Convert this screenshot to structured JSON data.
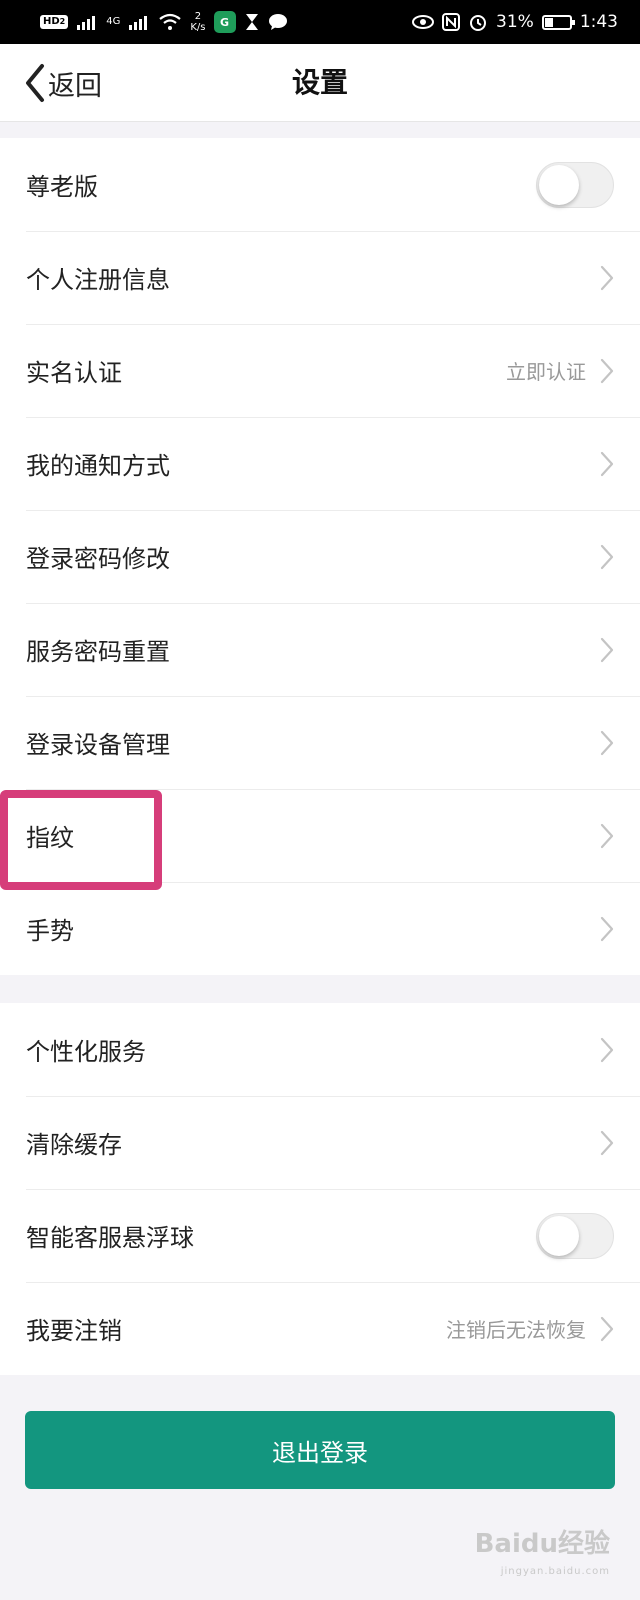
{
  "status_bar": {
    "left_badge": "HD",
    "left_badge_sub": "2",
    "signal1_icon": "signal-x-icon",
    "network_type": "4G",
    "speed_value": "2",
    "speed_unit": "K/s",
    "app_icon_label": "G",
    "battery_percent": "31%",
    "battery_level": 0.31,
    "time": "1:43"
  },
  "nav": {
    "back_label": "返回",
    "title": "设置"
  },
  "group1": {
    "items": [
      {
        "label": "尊老版",
        "type": "toggle",
        "on": false
      },
      {
        "label": "个人注册信息",
        "type": "link"
      },
      {
        "label": "实名认证",
        "type": "link",
        "value": "立即认证"
      },
      {
        "label": "我的通知方式",
        "type": "link"
      },
      {
        "label": "登录密码修改",
        "type": "link"
      },
      {
        "label": "服务密码重置",
        "type": "link"
      },
      {
        "label": "登录设备管理",
        "type": "link"
      },
      {
        "label": "指纹",
        "type": "link"
      },
      {
        "label": "手势",
        "type": "link"
      }
    ]
  },
  "group2": {
    "items": [
      {
        "label": "个性化服务",
        "type": "link"
      },
      {
        "label": "清除缓存",
        "type": "link"
      },
      {
        "label": "智能客服悬浮球",
        "type": "toggle",
        "on": false
      },
      {
        "label": "我要注销",
        "type": "link",
        "value": "注销后无法恢复"
      }
    ]
  },
  "logout_label": "退出登录",
  "watermark": {
    "text": "Baidu经验",
    "sub": "jingyan.baidu.com"
  },
  "colors": {
    "accent": "#13967f",
    "highlight": "#d63d7a"
  }
}
